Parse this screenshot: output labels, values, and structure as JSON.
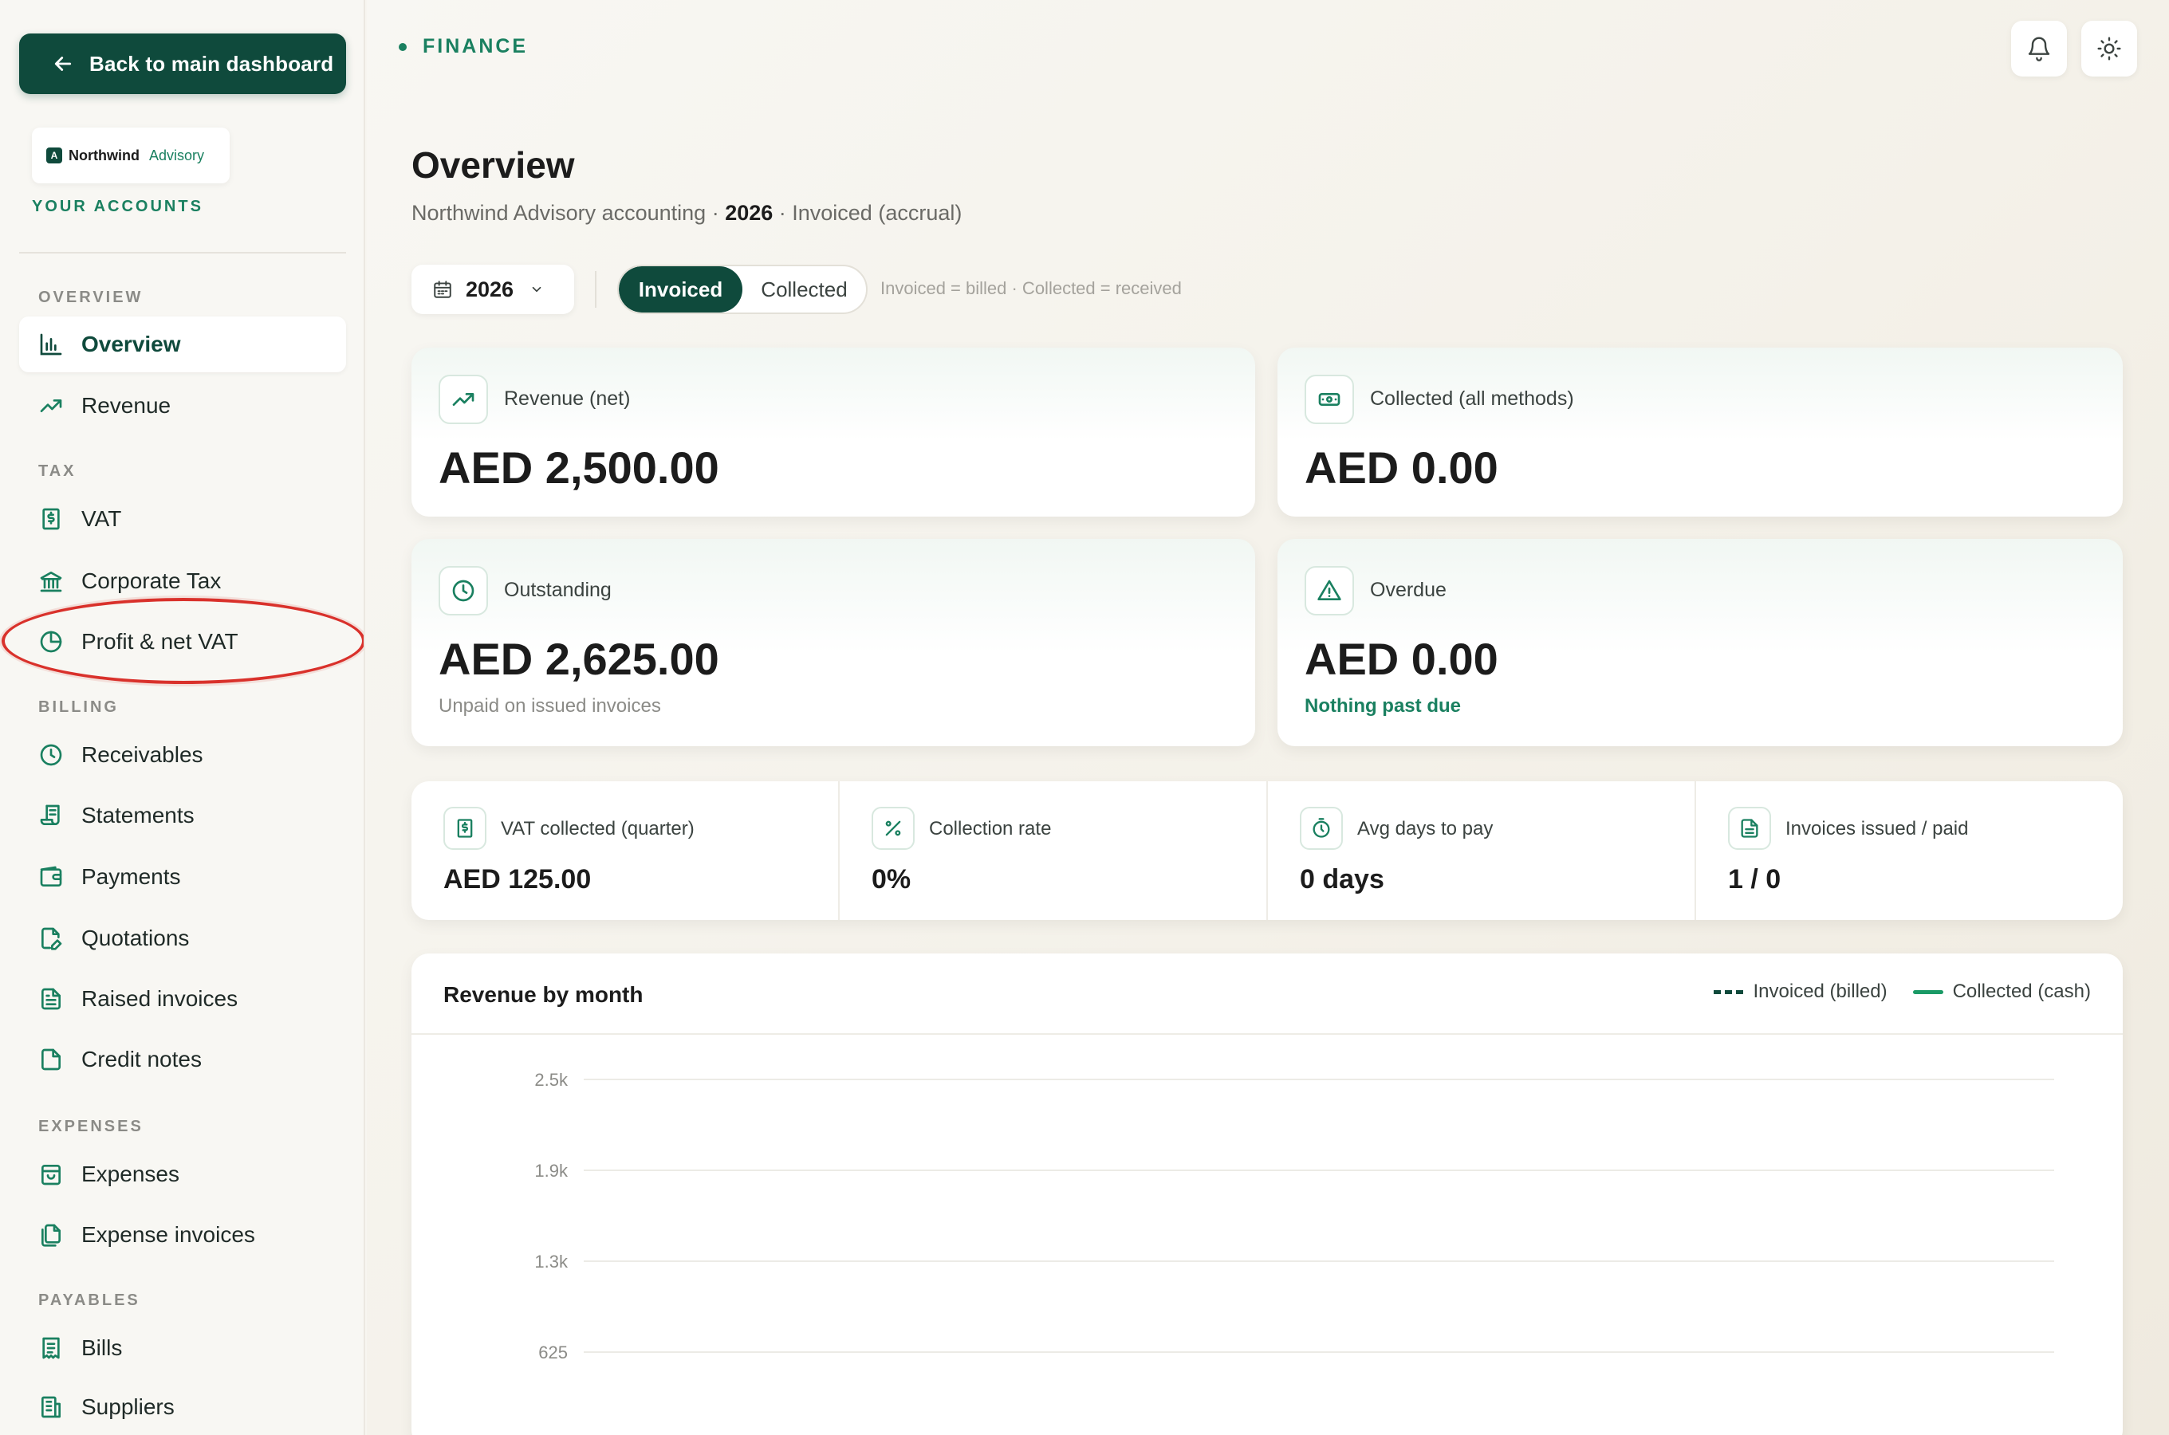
{
  "sidebar": {
    "back_label": "Back to main dashboard",
    "logo": {
      "name": "Northwind",
      "sub": "Advisory",
      "mark": "A"
    },
    "your_accounts": "YOUR ACCOUNTS",
    "sections": {
      "overview": "OVERVIEW",
      "tax": "TAX",
      "billing": "BILLING",
      "expenses": "EXPENSES",
      "payables": "PAYABLES"
    },
    "items": {
      "overview": "Overview",
      "revenue": "Revenue",
      "vat": "VAT",
      "corporate_tax": "Corporate Tax",
      "profit_net_vat": "Profit & net VAT",
      "receivables": "Receivables",
      "statements": "Statements",
      "payments": "Payments",
      "quotations": "Quotations",
      "raised_invoices": "Raised invoices",
      "credit_notes": "Credit notes",
      "expenses": "Expenses",
      "expense_invoices": "Expense invoices",
      "bills": "Bills",
      "suppliers": "Suppliers"
    }
  },
  "header": {
    "crumb": "FINANCE",
    "title": "Overview",
    "subtitle_prefix": "Northwind Advisory accounting · ",
    "subtitle_year": "2026",
    "subtitle_suffix": " · Invoiced (accrual)"
  },
  "filters": {
    "year": "2026",
    "toggle_invoiced": "Invoiced",
    "toggle_collected": "Collected",
    "hint": "Invoiced = billed · Collected = received"
  },
  "kpis": {
    "revenue": {
      "label": "Revenue (net)",
      "value": "AED 2,500.00"
    },
    "collected": {
      "label": "Collected (all methods)",
      "value": "AED 0.00"
    },
    "outstanding": {
      "label": "Outstanding",
      "value": "AED 2,625.00",
      "note": "Unpaid on issued invoices"
    },
    "overdue": {
      "label": "Overdue",
      "value": "AED 0.00",
      "note": "Nothing past due"
    }
  },
  "stats": {
    "vat": {
      "label": "VAT collected (quarter)",
      "value": "AED 125.00"
    },
    "rate": {
      "label": "Collection rate",
      "value": "0%"
    },
    "days": {
      "label": "Avg days to pay",
      "value": "0 days"
    },
    "invoices": {
      "label": "Invoices issued / paid",
      "value": "1 / 0"
    }
  },
  "chart_data": {
    "type": "line",
    "title": "Revenue by month",
    "legend": [
      "Invoiced (billed)",
      "Collected (cash)"
    ],
    "y_ticks": [
      "2.5k",
      "1.9k",
      "1.3k",
      "625"
    ],
    "ylim": [
      0,
      2500
    ],
    "grid": true,
    "legend_position": "top-right"
  },
  "colors": {
    "brand": "#0f4a3c",
    "accent": "#1a8060",
    "highlight": "#d9312b"
  }
}
